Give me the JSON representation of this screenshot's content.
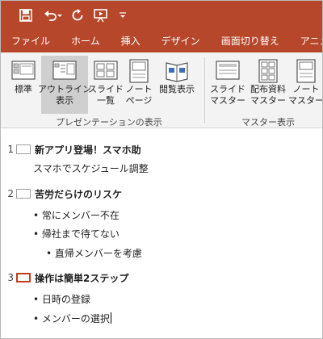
{
  "qat": {
    "save": "save-icon",
    "undo": "undo-icon",
    "redo": "repeat-icon",
    "present": "start-from-beginning-icon",
    "customize": "customize-quick-access-icon"
  },
  "tabs": [
    "ファイル",
    "ホーム",
    "挿入",
    "デザイン",
    "画面切り替え",
    "アニメーション"
  ],
  "ribbon": {
    "presentation_views": {
      "label": "プレゼンテーションの表示",
      "buttons": [
        {
          "label": "標準",
          "icon": "normal-view-icon"
        },
        {
          "label": "アウトライン\n表示",
          "icon": "outline-view-icon",
          "selected": true
        },
        {
          "label": "スライド\n一覧",
          "icon": "slide-sorter-icon"
        },
        {
          "label": "ノート\nページ",
          "icon": "notes-page-icon"
        },
        {
          "label": "閲覧表示",
          "icon": "reading-view-icon"
        }
      ]
    },
    "master_views": {
      "label": "マスター表示",
      "buttons": [
        {
          "label": "スライド\nマスター",
          "icon": "slide-master-icon"
        },
        {
          "label": "配布資料\nマスター",
          "icon": "handout-master-icon"
        },
        {
          "label": "ノート\nマスター",
          "icon": "notes-master-icon"
        }
      ]
    }
  },
  "outline": {
    "slides": [
      {
        "number": "1",
        "title": "新アプリ登場！スマホ助",
        "lines": [
          "スマホでスケジュール調整"
        ]
      },
      {
        "number": "2",
        "title": "苦労だらけのリスケ",
        "lines": [
          "• 常にメンバー不在",
          "• 帰社まで待てない",
          "• 直帰メンバーを考慮"
        ]
      },
      {
        "number": "3",
        "title": "操作は簡単2ステップ",
        "lines": [
          "• 日時の登録",
          "• メンバーの選択"
        ],
        "current": true
      }
    ]
  }
}
